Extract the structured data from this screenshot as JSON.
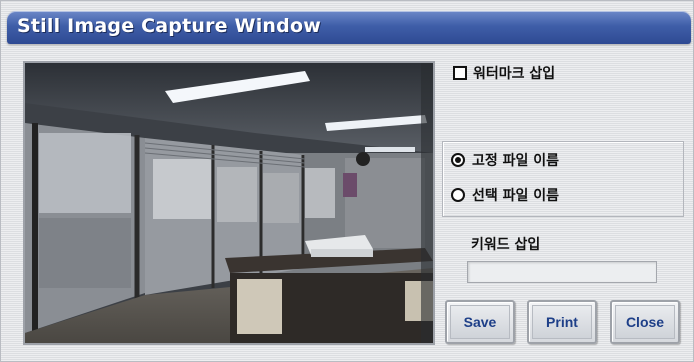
{
  "window": {
    "title": "Still Image Capture Window"
  },
  "options": {
    "watermark_label": "워터마크 삽입",
    "watermark_checked": false,
    "radio_fixed_label": "고정 파일 이름",
    "radio_select_label": "선택 파일 이름",
    "selected_radio": "fixed"
  },
  "keyword": {
    "label": "키워드 삽입",
    "value": ""
  },
  "buttons": {
    "save": "Save",
    "print": "Print",
    "close": "Close"
  },
  "colors": {
    "titlebar": "#3f5ea8",
    "button_text": "#1e3f88",
    "window_bg": "#e3e5e8"
  }
}
